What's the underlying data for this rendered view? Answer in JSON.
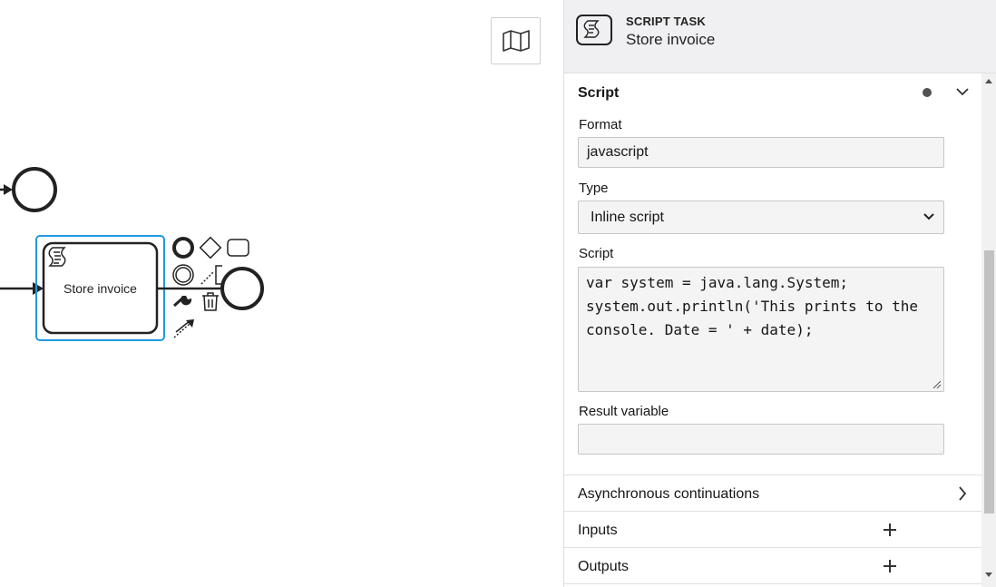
{
  "panel": {
    "header": {
      "element_type": "SCRIPT TASK",
      "element_name": "Store invoice",
      "icon": "script-task-icon"
    },
    "script_group": {
      "title": "Script",
      "format_label": "Format",
      "format_value": "javascript",
      "type_label": "Type",
      "type_value": "Inline script",
      "script_label": "Script",
      "script_value": "var system = java.lang.System;\nsystem.out.println('This prints to the console. Date = ' + date);",
      "result_variable_label": "Result variable",
      "result_variable_value": ""
    },
    "groups": [
      {
        "title": "Asynchronous continuations",
        "action": "chevron-right-icon"
      },
      {
        "title": "Inputs",
        "action": "plus-icon"
      },
      {
        "title": "Outputs",
        "action": "plus-icon"
      }
    ]
  },
  "canvas": {
    "task_label": "Store invoice",
    "minimap_icon": "map-icon",
    "context_pad_icons": [
      "end-event-icon",
      "gateway-icon",
      "task-icon",
      "intermediate-event-icon",
      "text-annotation-icon",
      "wrench-icon",
      "trash-icon",
      "connect-icon"
    ]
  },
  "colors": {
    "selection": "#1e9ae0",
    "header_bg": "#f0f0f2",
    "field_bg": "#f4f4f4"
  }
}
